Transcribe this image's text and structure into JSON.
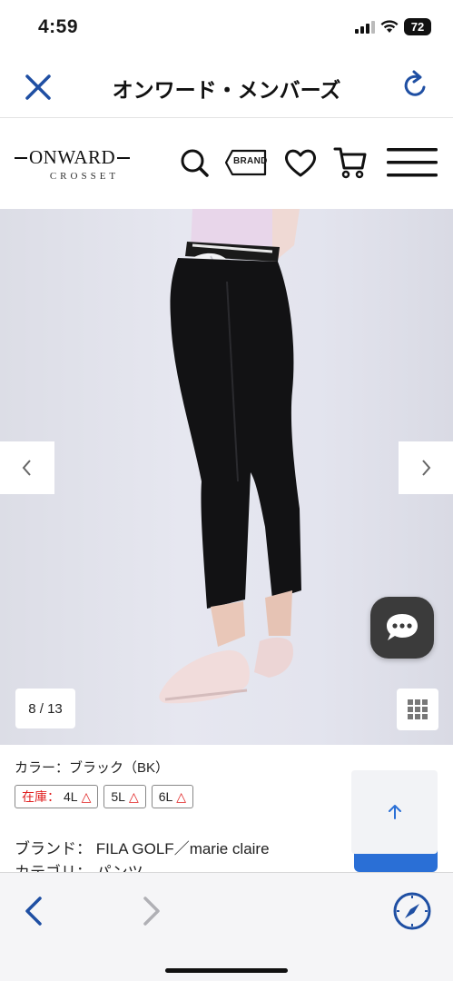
{
  "status_bar": {
    "time": "4:59",
    "battery": "72"
  },
  "browser_nav": {
    "title": "オンワード・メンバーズ"
  },
  "site_header": {
    "logo_main": "ONWARD",
    "logo_sub": "CROSSET",
    "brand_button_label": "BRAND"
  },
  "gallery": {
    "counter": "8 / 13"
  },
  "product": {
    "color_label": "カラー：ブラック（BK）",
    "stock_label": "在庫：",
    "sizes": [
      {
        "size": "4L",
        "mark": "△"
      },
      {
        "size": "5L",
        "mark": "△"
      },
      {
        "size": "6L",
        "mark": "△"
      }
    ],
    "brand_line": "ブランド： FILA GOLF／marie claire",
    "category_line": "カテゴリ： パンツ"
  },
  "colors": {
    "accent_blue": "#1f4fa3",
    "stock_red": "#e02020",
    "chat_bg": "#3b3b3b"
  }
}
